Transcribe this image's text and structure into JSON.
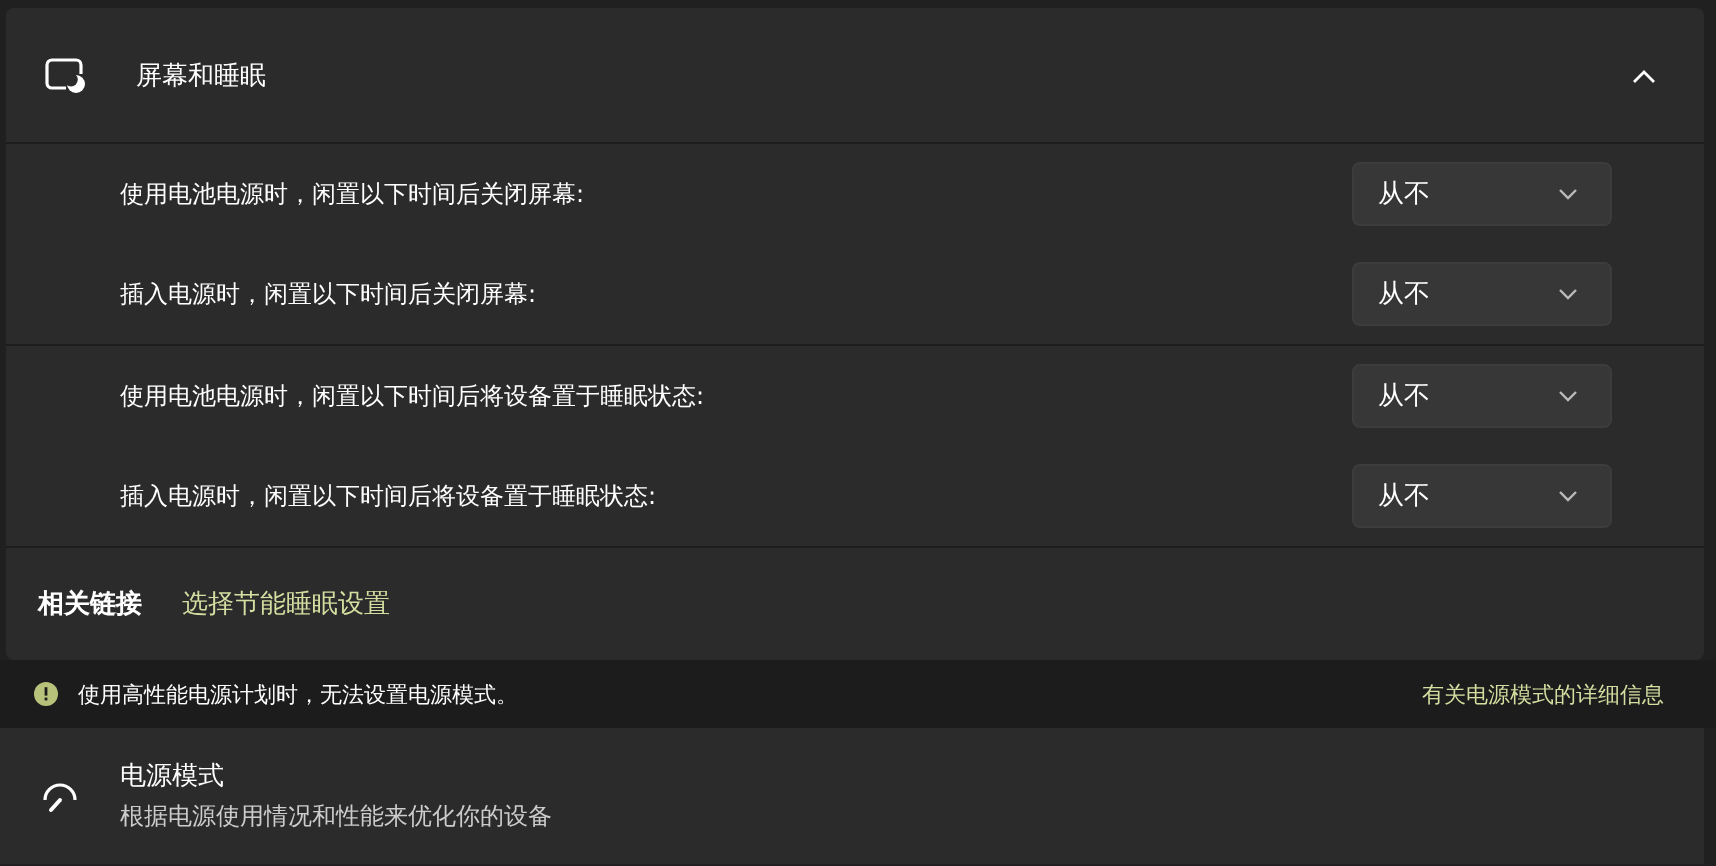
{
  "section": {
    "title": "屏幕和睡眠",
    "expanded": true
  },
  "settings": [
    {
      "label": "使用电池电源时，闲置以下时间后关闭屏幕:",
      "value": "从不",
      "group_end": false
    },
    {
      "label": "插入电源时，闲置以下时间后关闭屏幕:",
      "value": "从不",
      "group_end": true
    },
    {
      "label": "使用电池电源时，闲置以下时间后将设备置于睡眠状态:",
      "value": "从不",
      "group_end": false
    },
    {
      "label": "插入电源时，闲置以下时间后将设备置于睡眠状态:",
      "value": "从不",
      "group_end": true
    }
  ],
  "related_links": {
    "heading": "相关链接",
    "links": [
      "选择节能睡眠设置"
    ]
  },
  "notice": {
    "text": "使用高性能电源计划时，无法设置电源模式。",
    "link": "有关电源模式的详细信息"
  },
  "power_mode": {
    "title": "电源模式",
    "description": "根据电源使用情况和性能来优化你的设备"
  }
}
